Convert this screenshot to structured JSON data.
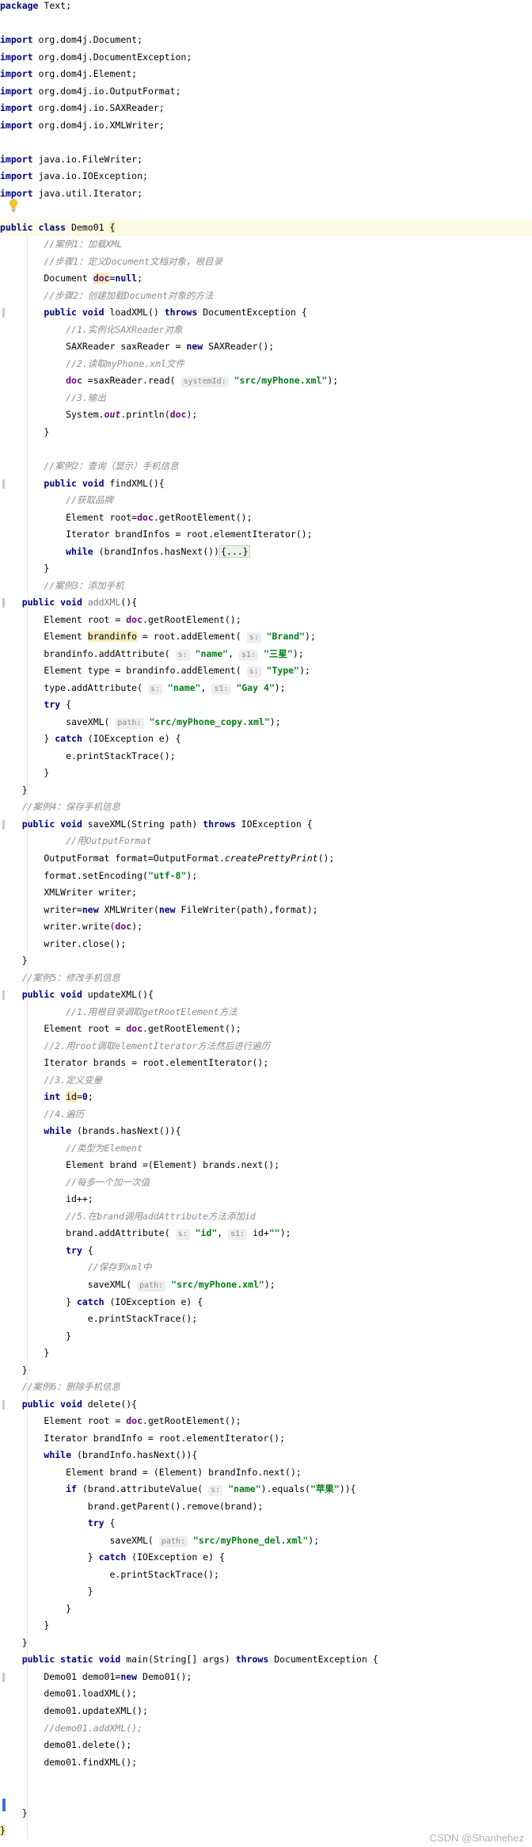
{
  "editor": {
    "lines": [
      [
        {
          "t": "package",
          "c": "kw"
        },
        {
          "t": " Text;"
        }
      ],
      [],
      [
        {
          "t": "import",
          "c": "kw"
        },
        {
          "t": " org.dom4j.Document;"
        }
      ],
      [
        {
          "t": "import",
          "c": "kw"
        },
        {
          "t": " org.dom4j.DocumentException;"
        }
      ],
      [
        {
          "t": "import",
          "c": "kw"
        },
        {
          "t": " org.dom4j.Element;"
        }
      ],
      [
        {
          "t": "import",
          "c": "kw"
        },
        {
          "t": " org.dom4j.io.OutputFormat;"
        }
      ],
      [
        {
          "t": "import",
          "c": "kw"
        },
        {
          "t": " org.dom4j.io.SAXReader;"
        }
      ],
      [
        {
          "t": "import",
          "c": "kw"
        },
        {
          "t": " org.dom4j.io.XMLWriter;"
        }
      ],
      [],
      [
        {
          "t": "import",
          "c": "kw"
        },
        {
          "t": " java.io.FileWriter;"
        }
      ],
      [
        {
          "t": "import",
          "c": "kw"
        },
        {
          "t": " java.io.IOException;"
        }
      ],
      [
        {
          "t": "import",
          "c": "kw"
        },
        {
          "t": " java.util.Iterator;"
        }
      ],
      [],
      [
        {
          "t": "public class",
          "c": "kw"
        },
        {
          "t": " Demo01 "
        },
        {
          "t": "{",
          "c": "warnbg"
        }
      ],
      [
        {
          "t": "        "
        },
        {
          "t": "//案例1：加载XML",
          "c": "cmt"
        }
      ],
      [
        {
          "t": "        "
        },
        {
          "t": "//步骤1：定义Document文档对象，根目录",
          "c": "cmt"
        }
      ],
      [
        {
          "t": "        Document "
        },
        {
          "t": "doc",
          "c": "fld warnbg"
        },
        {
          "t": "="
        },
        {
          "t": "null",
          "c": "kw"
        },
        {
          "t": ";"
        }
      ],
      [
        {
          "t": "        "
        },
        {
          "t": "//步骤2：创建加载Document对象的方法",
          "c": "cmt"
        }
      ],
      [
        {
          "t": "        "
        },
        {
          "t": "public void",
          "c": "kw"
        },
        {
          "t": " loadXML() "
        },
        {
          "t": "throws",
          "c": "kw"
        },
        {
          "t": " DocumentException {"
        }
      ],
      [
        {
          "t": "            "
        },
        {
          "t": "//1.实例化SAXReader对象",
          "c": "cmt"
        }
      ],
      [
        {
          "t": "            SAXReader saxReader = "
        },
        {
          "t": "new",
          "c": "kw"
        },
        {
          "t": " SAXReader();"
        }
      ],
      [
        {
          "t": "            "
        },
        {
          "t": "//2.读取myPhone.xml文件",
          "c": "cmt"
        }
      ],
      [
        {
          "t": "            "
        },
        {
          "t": "doc",
          "c": "fld"
        },
        {
          "t": " =saxReader.read( "
        },
        {
          "t": "systemId:",
          "c": "hint"
        },
        {
          "t": " "
        },
        {
          "t": "\"src/myPhone.xml\"",
          "c": "str"
        },
        {
          "t": ");"
        }
      ],
      [
        {
          "t": "            "
        },
        {
          "t": "//3.输出",
          "c": "cmt"
        }
      ],
      [
        {
          "t": "            System."
        },
        {
          "t": "out",
          "c": "fldi"
        },
        {
          "t": ".println("
        },
        {
          "t": "doc",
          "c": "fld"
        },
        {
          "t": ");"
        }
      ],
      [
        {
          "t": "        }"
        }
      ],
      [],
      [
        {
          "t": "        "
        },
        {
          "t": "//案例2：查询（显示）手机信息",
          "c": "cmt"
        }
      ],
      [
        {
          "t": "        "
        },
        {
          "t": "public void",
          "c": "kw"
        },
        {
          "t": " findXML(){"
        }
      ],
      [
        {
          "t": "            "
        },
        {
          "t": "//获取品牌",
          "c": "cmt"
        }
      ],
      [
        {
          "t": "            Element root="
        },
        {
          "t": "doc",
          "c": "fld"
        },
        {
          "t": ".getRootElement();"
        }
      ],
      [
        {
          "t": "            Iterator brandInfos = root.elementIterator();"
        }
      ],
      [
        {
          "t": "            "
        },
        {
          "t": "while",
          "c": "kw"
        },
        {
          "t": " (brandInfos.hasNext())"
        },
        {
          "t": "{...}",
          "c": "fold"
        }
      ],
      [
        {
          "t": "        }"
        }
      ],
      [
        {
          "t": "        "
        },
        {
          "t": "//案例3：添加手机",
          "c": "cmt"
        }
      ],
      [
        {
          "t": "    "
        },
        {
          "t": "public void",
          "c": "kw"
        },
        {
          "t": " "
        },
        {
          "t": "addXML",
          "c": "unused"
        },
        {
          "t": "(){"
        }
      ],
      [
        {
          "t": "        Element root = "
        },
        {
          "t": "doc",
          "c": "fld"
        },
        {
          "t": ".getRootElement();"
        }
      ],
      [
        {
          "t": "        Element "
        },
        {
          "t": "brandinfo",
          "c": "warnbg"
        },
        {
          "t": " = root.addElement( "
        },
        {
          "t": "s:",
          "c": "hint"
        },
        {
          "t": " "
        },
        {
          "t": "\"Brand\"",
          "c": "str"
        },
        {
          "t": ");"
        }
      ],
      [
        {
          "t": "        brandinfo.addAttribute( "
        },
        {
          "t": "s:",
          "c": "hint"
        },
        {
          "t": " "
        },
        {
          "t": "\"name\"",
          "c": "str"
        },
        {
          "t": ", "
        },
        {
          "t": "s1:",
          "c": "hint"
        },
        {
          "t": " "
        },
        {
          "t": "\"三星\"",
          "c": "str"
        },
        {
          "t": ");"
        }
      ],
      [
        {
          "t": "        Element type = brandinfo.addElement( "
        },
        {
          "t": "s:",
          "c": "hint"
        },
        {
          "t": " "
        },
        {
          "t": "\"Type\"",
          "c": "str"
        },
        {
          "t": ");"
        }
      ],
      [
        {
          "t": "        type.addAttribute( "
        },
        {
          "t": "s:",
          "c": "hint"
        },
        {
          "t": " "
        },
        {
          "t": "\"name\"",
          "c": "str"
        },
        {
          "t": ", "
        },
        {
          "t": "s1:",
          "c": "hint"
        },
        {
          "t": " "
        },
        {
          "t": "\"Gay 4\"",
          "c": "str"
        },
        {
          "t": ");"
        }
      ],
      [
        {
          "t": "        "
        },
        {
          "t": "try",
          "c": "kw"
        },
        {
          "t": " {"
        }
      ],
      [
        {
          "t": "            saveXML( "
        },
        {
          "t": "path:",
          "c": "hint"
        },
        {
          "t": " "
        },
        {
          "t": "\"src/myPhone_copy.xml\"",
          "c": "str"
        },
        {
          "t": ");"
        }
      ],
      [
        {
          "t": "        } "
        },
        {
          "t": "catch",
          "c": "kw"
        },
        {
          "t": " (IOException e) {"
        }
      ],
      [
        {
          "t": "            e.printStackTrace();"
        }
      ],
      [
        {
          "t": "        }"
        }
      ],
      [
        {
          "t": "    }"
        }
      ],
      [
        {
          "t": "    "
        },
        {
          "t": "//案例4：保存手机信息",
          "c": "cmt"
        }
      ],
      [
        {
          "t": "    "
        },
        {
          "t": "public void",
          "c": "kw"
        },
        {
          "t": " saveXML(String path) "
        },
        {
          "t": "throws",
          "c": "kw"
        },
        {
          "t": " IOException {"
        }
      ],
      [
        {
          "t": "            "
        },
        {
          "t": "//用OutputFormat",
          "c": "cmt"
        }
      ],
      [
        {
          "t": "        OutputFormat format=OutputFormat."
        },
        {
          "t": "createPrettyPrint",
          "c": "stat"
        },
        {
          "t": "();"
        }
      ],
      [
        {
          "t": "        format.setEncoding("
        },
        {
          "t": "\"utf-8\"",
          "c": "str"
        },
        {
          "t": ");"
        }
      ],
      [
        {
          "t": "        XMLWriter writer;"
        }
      ],
      [
        {
          "t": "        writer="
        },
        {
          "t": "new",
          "c": "kw"
        },
        {
          "t": " XMLWriter("
        },
        {
          "t": "new",
          "c": "kw"
        },
        {
          "t": " FileWriter(path),format);"
        }
      ],
      [
        {
          "t": "        writer.write("
        },
        {
          "t": "doc",
          "c": "fld"
        },
        {
          "t": ");"
        }
      ],
      [
        {
          "t": "        writer.close();"
        }
      ],
      [
        {
          "t": "    }"
        }
      ],
      [
        {
          "t": "    "
        },
        {
          "t": "//案例5：修改手机信息",
          "c": "cmt"
        }
      ],
      [
        {
          "t": "    "
        },
        {
          "t": "public void",
          "c": "kw"
        },
        {
          "t": " updateXML(){"
        }
      ],
      [
        {
          "t": "            "
        },
        {
          "t": "//1.用根目录调取getRootElement方法",
          "c": "cmt"
        }
      ],
      [
        {
          "t": "        Element root = "
        },
        {
          "t": "doc",
          "c": "fld"
        },
        {
          "t": ".getRootElement();"
        }
      ],
      [
        {
          "t": "        "
        },
        {
          "t": "//2.用root调取elementIterator方法然后进行遍历",
          "c": "cmt"
        }
      ],
      [
        {
          "t": "        Iterator brands = root.elementIterator();"
        }
      ],
      [
        {
          "t": "        "
        },
        {
          "t": "//3.定义变量",
          "c": "cmt"
        }
      ],
      [
        {
          "t": "        "
        },
        {
          "t": "int",
          "c": "kw"
        },
        {
          "t": " "
        },
        {
          "t": "id",
          "c": "warnbg"
        },
        {
          "t": "="
        },
        {
          "t": "0",
          "c": "kw"
        },
        {
          "t": ";"
        }
      ],
      [
        {
          "t": "        "
        },
        {
          "t": "//4.遍历",
          "c": "cmt"
        }
      ],
      [
        {
          "t": "        "
        },
        {
          "t": "while",
          "c": "kw"
        },
        {
          "t": " (brands.hasNext()){"
        }
      ],
      [
        {
          "t": "            "
        },
        {
          "t": "//类型为Element",
          "c": "cmt"
        }
      ],
      [
        {
          "t": "            Element brand =(Element) brands.next();"
        }
      ],
      [
        {
          "t": "            "
        },
        {
          "t": "//每多一个加一次值",
          "c": "cmt"
        }
      ],
      [
        {
          "t": "            id++;"
        }
      ],
      [
        {
          "t": "            "
        },
        {
          "t": "//5.在brand调用addAttribute方法添加id",
          "c": "cmt"
        }
      ],
      [
        {
          "t": "            brand.addAttribute( "
        },
        {
          "t": "s:",
          "c": "hint"
        },
        {
          "t": " "
        },
        {
          "t": "\"id\"",
          "c": "str"
        },
        {
          "t": ", "
        },
        {
          "t": "s1:",
          "c": "hint"
        },
        {
          "t": " id+"
        },
        {
          "t": "\"\"",
          "c": "str"
        },
        {
          "t": ");"
        }
      ],
      [
        {
          "t": "            "
        },
        {
          "t": "try",
          "c": "kw"
        },
        {
          "t": " {"
        }
      ],
      [
        {
          "t": "                "
        },
        {
          "t": "//保存到xml中",
          "c": "cmt"
        }
      ],
      [
        {
          "t": "                saveXML( "
        },
        {
          "t": "path:",
          "c": "hint"
        },
        {
          "t": " "
        },
        {
          "t": "\"src/myPhone.xml\"",
          "c": "str"
        },
        {
          "t": ");"
        }
      ],
      [
        {
          "t": "            } "
        },
        {
          "t": "catch",
          "c": "kw"
        },
        {
          "t": " (IOException e) {"
        }
      ],
      [
        {
          "t": "                e.printStackTrace();"
        }
      ],
      [
        {
          "t": "            }"
        }
      ],
      [
        {
          "t": "        }"
        }
      ],
      [
        {
          "t": "    }"
        }
      ],
      [
        {
          "t": "    "
        },
        {
          "t": "//案例6：删除手机信息",
          "c": "cmt"
        }
      ],
      [
        {
          "t": "    "
        },
        {
          "t": "public void",
          "c": "kw"
        },
        {
          "t": " delete(){"
        }
      ],
      [
        {
          "t": "        Element root = "
        },
        {
          "t": "doc",
          "c": "fld"
        },
        {
          "t": ".getRootElement();"
        }
      ],
      [
        {
          "t": "        Iterator brandInfo = root.elementIterator();"
        }
      ],
      [
        {
          "t": "        "
        },
        {
          "t": "while",
          "c": "kw"
        },
        {
          "t": " (brandInfo.hasNext()){"
        }
      ],
      [
        {
          "t": "            Element brand = (Element) brandInfo.next();"
        }
      ],
      [
        {
          "t": "            "
        },
        {
          "t": "if",
          "c": "kw"
        },
        {
          "t": " (brand.attributeValue( "
        },
        {
          "t": "s:",
          "c": "hint"
        },
        {
          "t": " "
        },
        {
          "t": "\"name\"",
          "c": "str"
        },
        {
          "t": ").equals("
        },
        {
          "t": "\"苹果\"",
          "c": "str"
        },
        {
          "t": ")){"
        }
      ],
      [
        {
          "t": "                brand.getParent().remove(brand);"
        }
      ],
      [
        {
          "t": "                "
        },
        {
          "t": "try",
          "c": "kw"
        },
        {
          "t": " {"
        }
      ],
      [
        {
          "t": "                    saveXML( "
        },
        {
          "t": "path:",
          "c": "hint"
        },
        {
          "t": " "
        },
        {
          "t": "\"src/myPhone_del.xml\"",
          "c": "str"
        },
        {
          "t": ");"
        }
      ],
      [
        {
          "t": "                } "
        },
        {
          "t": "catch",
          "c": "kw"
        },
        {
          "t": " (IOException e) {"
        }
      ],
      [
        {
          "t": "                    e.printStackTrace();"
        }
      ],
      [
        {
          "t": "                }"
        }
      ],
      [
        {
          "t": "            }"
        }
      ],
      [
        {
          "t": "        }"
        }
      ],
      [
        {
          "t": "    }"
        }
      ],
      [
        {
          "t": "    "
        },
        {
          "t": "public static void",
          "c": "kw"
        },
        {
          "t": " main(String[] args) "
        },
        {
          "t": "throws",
          "c": "kw"
        },
        {
          "t": " DocumentException {"
        }
      ],
      [
        {
          "t": "        Demo01 demo01="
        },
        {
          "t": "new",
          "c": "kw"
        },
        {
          "t": " Demo01();"
        }
      ],
      [
        {
          "t": "        demo01.loadXML();"
        }
      ],
      [
        {
          "t": "        demo01.updateXML();"
        }
      ],
      [
        {
          "t": "        "
        },
        {
          "t": "//demo01.addXML();",
          "c": "cmt"
        }
      ],
      [
        {
          "t": "        demo01.delete();"
        }
      ],
      [
        {
          "t": "        demo01.findXML();"
        }
      ],
      [],
      [],
      [
        {
          "t": "    }"
        }
      ],
      [
        {
          "t": "}",
          "c": "warnbg"
        }
      ]
    ]
  },
  "watermark": "CSDN @Shanhehez",
  "icons": {
    "intention": "lightbulb-icon"
  }
}
